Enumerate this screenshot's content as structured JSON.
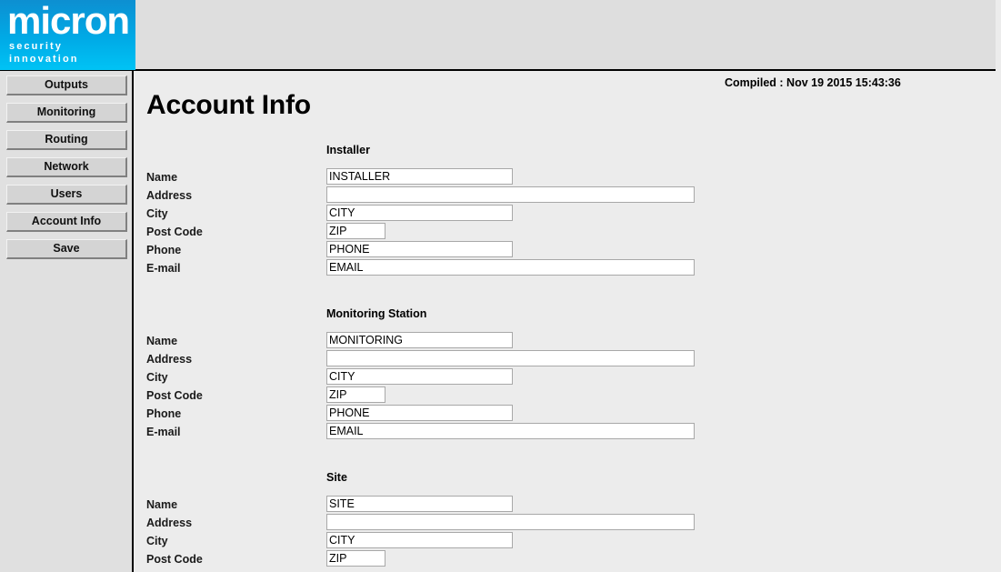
{
  "brand": {
    "name": "micron",
    "tagline": "security innovation"
  },
  "header": {
    "compiled": "Compiled : Nov 19 2015 15:43:36"
  },
  "page": {
    "title": "Account Info"
  },
  "sidebar": {
    "items": [
      {
        "label": "Outputs"
      },
      {
        "label": "Monitoring"
      },
      {
        "label": "Routing"
      },
      {
        "label": "Network"
      },
      {
        "label": "Users"
      },
      {
        "label": "Account Info"
      },
      {
        "label": "Save"
      }
    ]
  },
  "sections": [
    {
      "title": "Installer",
      "fields": [
        {
          "label": "Name",
          "value": "INSTALLER"
        },
        {
          "label": "Address",
          "value": ""
        },
        {
          "label": "City",
          "value": "CITY"
        },
        {
          "label": "Post Code",
          "value": "ZIP"
        },
        {
          "label": "Phone",
          "value": "PHONE"
        },
        {
          "label": "E-mail",
          "value": "EMAIL"
        }
      ]
    },
    {
      "title": "Monitoring Station",
      "fields": [
        {
          "label": "Name",
          "value": "MONITORING"
        },
        {
          "label": "Address",
          "value": ""
        },
        {
          "label": "City",
          "value": "CITY"
        },
        {
          "label": "Post Code",
          "value": "ZIP"
        },
        {
          "label": "Phone",
          "value": "PHONE"
        },
        {
          "label": "E-mail",
          "value": "EMAIL"
        }
      ]
    },
    {
      "title": "Site",
      "fields": [
        {
          "label": "Name",
          "value": "SITE"
        },
        {
          "label": "Address",
          "value": ""
        },
        {
          "label": "City",
          "value": "CITY"
        },
        {
          "label": "Post Code",
          "value": "ZIP"
        }
      ]
    }
  ],
  "colors": {
    "brand_blue_top": "#0d8fd1",
    "brand_cyan_bottom": "#00c3f5",
    "header_bg": "#dedede",
    "sidebar_bg": "#e0e0e0",
    "content_bg": "#ececec",
    "button_face": "#d4d4d4"
  }
}
